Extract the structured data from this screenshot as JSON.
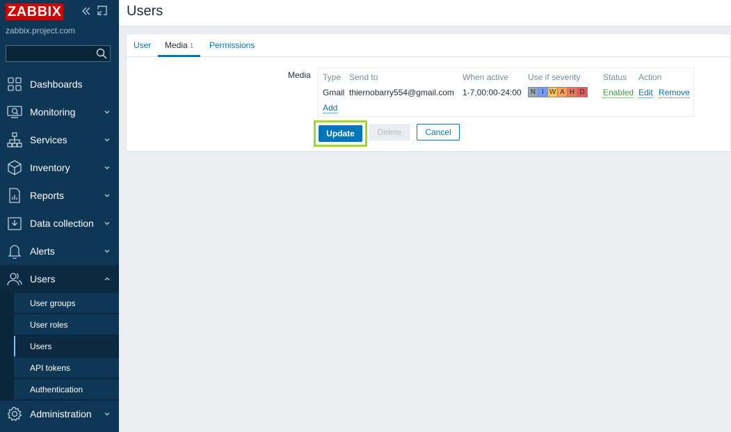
{
  "sidebar": {
    "brand": "ZABBIX",
    "server_name": "zabbix.project.com",
    "search": {
      "value": "",
      "placeholder": ""
    },
    "items": [
      {
        "label": "Dashboards"
      },
      {
        "label": "Monitoring"
      },
      {
        "label": "Services"
      },
      {
        "label": "Inventory"
      },
      {
        "label": "Reports"
      },
      {
        "label": "Data collection"
      },
      {
        "label": "Alerts"
      },
      {
        "label": "Users"
      },
      {
        "label": "Administration"
      }
    ],
    "users_submenu": [
      {
        "label": "User groups"
      },
      {
        "label": "User roles"
      },
      {
        "label": "Users"
      },
      {
        "label": "API tokens"
      },
      {
        "label": "Authentication"
      }
    ]
  },
  "header": {
    "title": "Users"
  },
  "tabs": [
    {
      "label": "User"
    },
    {
      "label": "Media",
      "count": "1"
    },
    {
      "label": "Permissions"
    }
  ],
  "media": {
    "label": "Media",
    "columns": [
      "Type",
      "Send to",
      "When active",
      "Use if severity",
      "Status",
      "Action"
    ],
    "rows": [
      {
        "type": "Gmail",
        "send_to": "thiernobarry554@gmail.com",
        "when_active": "1-7,00:00-24:00",
        "severity": [
          "N",
          "I",
          "W",
          "A",
          "H",
          "D"
        ],
        "status": "Enabled",
        "actions": [
          "Edit",
          "Remove"
        ]
      }
    ],
    "add_label": "Add"
  },
  "buttons": {
    "update": "Update",
    "delete": "Delete",
    "cancel": "Cancel"
  },
  "colors": {
    "sidebar_bg": "#0e3655",
    "brand_red": "#d40000",
    "link_blue": "#0275b8",
    "enabled_green": "#429e47",
    "highlight_green": "#9fdb1c",
    "sev_not_classified": "#97aab3",
    "sev_information": "#7499ff",
    "sev_warning": "#ffc859",
    "sev_average": "#ffa059",
    "sev_high": "#e97659",
    "sev_disaster": "#e45959"
  }
}
